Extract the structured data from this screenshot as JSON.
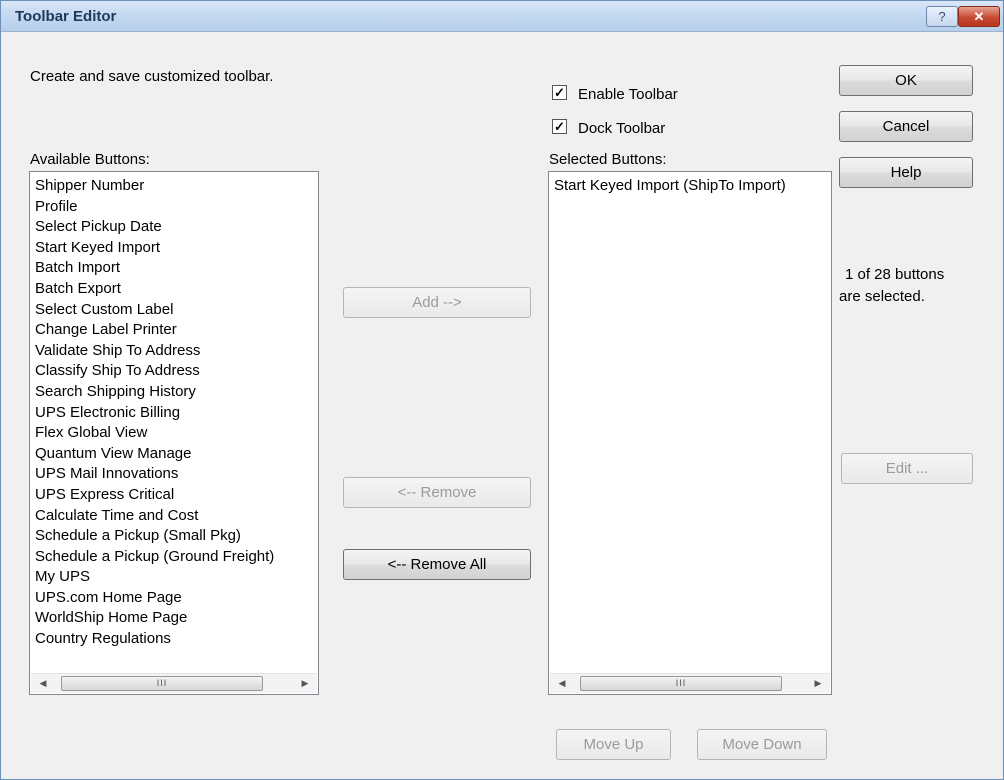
{
  "window": {
    "title": "Toolbar Editor",
    "help_glyph": "?",
    "close_glyph": "✕"
  },
  "description": "Create and save customized toolbar.",
  "enable_toolbar": {
    "label": "Enable Toolbar",
    "checked": true
  },
  "dock_toolbar": {
    "label": "Dock Toolbar",
    "checked": true
  },
  "available": {
    "label": "Available Buttons:",
    "items": [
      "Shipper Number",
      "Profile",
      "Select Pickup Date",
      "Start Keyed Import",
      "Batch Import",
      "Batch Export",
      "Select Custom Label",
      "Change Label Printer",
      "Validate Ship To Address",
      "Classify Ship To Address",
      "Search Shipping History",
      "UPS Electronic Billing",
      "Flex Global View",
      "Quantum View Manage",
      "UPS Mail Innovations",
      "UPS Express Critical",
      "Calculate Time and Cost",
      "Schedule a Pickup (Small Pkg)",
      "Schedule a Pickup (Ground Freight)",
      "My UPS",
      "UPS.com Home Page",
      "WorldShip Home Page",
      "Country Regulations"
    ]
  },
  "selected": {
    "label": "Selected Buttons:",
    "items": [
      "Start Keyed Import (ShipTo Import)"
    ]
  },
  "buttons": {
    "ok": "OK",
    "cancel": "Cancel",
    "help": "Help",
    "add": "Add -->",
    "remove": "<-- Remove",
    "remove_all": "<-- Remove All",
    "edit": "Edit ...",
    "move_up": "Move Up",
    "move_down": "Move Down"
  },
  "status": {
    "line1": "1 of 28 buttons",
    "line2": "are selected."
  },
  "scrollbar": {
    "left": "◀",
    "right": "▶",
    "thumb": "III"
  }
}
